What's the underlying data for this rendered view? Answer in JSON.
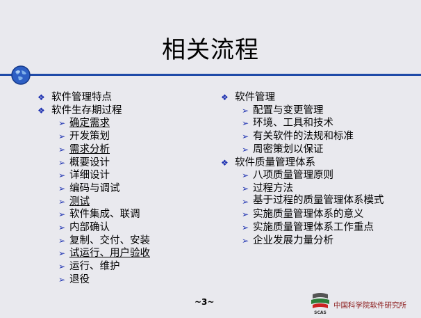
{
  "slide": {
    "title": "相关流程",
    "page_number": "~3~",
    "org_name": "中国科学院软件研究所",
    "logo_text": "SCAS"
  },
  "left": {
    "items": [
      {
        "label": "软件管理特点"
      },
      {
        "label": "软件生存期过程"
      }
    ],
    "sub": [
      {
        "label": "确定需求"
      },
      {
        "label": "开发策划"
      },
      {
        "label": "需求分析"
      },
      {
        "label": "概要设计"
      },
      {
        "label": "详细设计"
      },
      {
        "label": "编码与调试"
      },
      {
        "label": "测试"
      },
      {
        "label": "软件集成、联调"
      },
      {
        "label": "内部确认"
      },
      {
        "label": "复制、交付、安装"
      },
      {
        "label": "试运行、用户验收"
      },
      {
        "label": "运行、维护"
      },
      {
        "label": "退役"
      }
    ]
  },
  "right": {
    "items": [
      {
        "label": "软件管理"
      },
      {
        "label": "软件质量管理体系"
      }
    ],
    "sub1": [
      {
        "label": "配置与变更管理"
      },
      {
        "label": "环境、工具和技术"
      },
      {
        "label": "有关软件的法规和标准"
      },
      {
        "label": "周密策划以保证"
      }
    ],
    "sub2": [
      {
        "label": "八项质量管理原则"
      },
      {
        "label": "过程方法"
      },
      {
        "label": "基于过程的质量管理体系模式"
      },
      {
        "label": "实施质量管理体系的意义"
      },
      {
        "label": "实施质量管理体系工作重点"
      },
      {
        "label": "企业发展力量分析"
      }
    ]
  },
  "colors": {
    "rule": "#1f4aa8",
    "bullet": "#1b2fb0",
    "org_text": "#8b1a1a",
    "background": "#e9e9ee"
  },
  "icons": {
    "globe": "globe-icon",
    "bullet_l1": "diamond-cluster-bullet",
    "bullet_l2": "arrowhead-bullet",
    "logo": "scas-logo"
  }
}
